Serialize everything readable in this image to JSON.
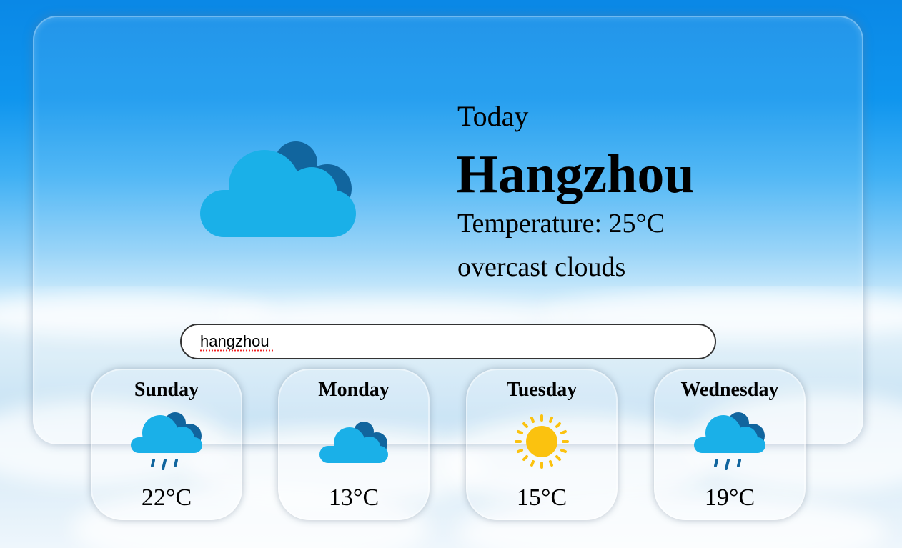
{
  "current": {
    "label": "Today",
    "city": "Hangzhou",
    "temperature": "Temperature: 25°C",
    "description": "overcast clouds",
    "icon": "overcast-clouds-icon"
  },
  "search": {
    "value": "hangzhou"
  },
  "forecast": [
    {
      "day": "Sunday",
      "temp": "22°C",
      "icon": "rain-cloud-icon"
    },
    {
      "day": "Monday",
      "temp": "13°C",
      "icon": "cloud-icon"
    },
    {
      "day": "Tuesday",
      "temp": "15°C",
      "icon": "sun-icon"
    },
    {
      "day": "Wednesday",
      "temp": "19°C",
      "icon": "rain-cloud-icon"
    }
  ],
  "colors": {
    "cloud_light": "#1ab0e8",
    "cloud_dark": "#11659e",
    "sun": "#fbc20f",
    "rain": "#11659e"
  }
}
